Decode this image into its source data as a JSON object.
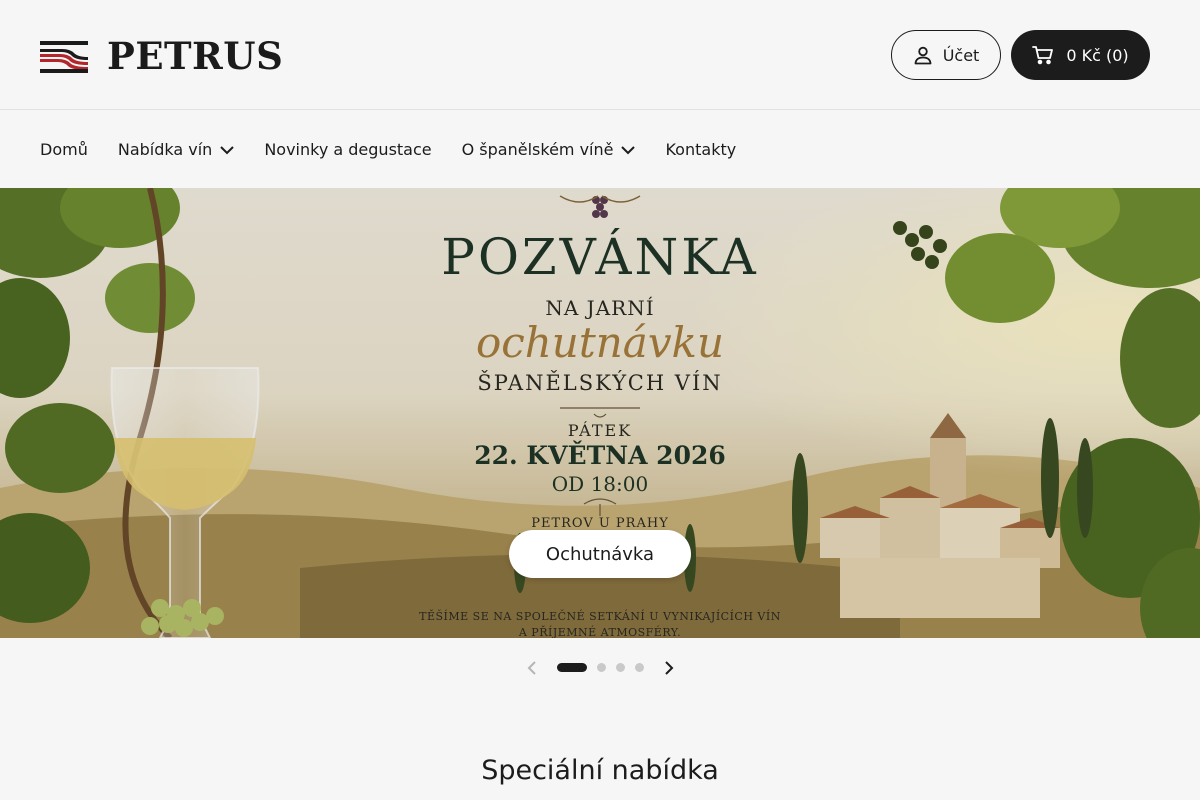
{
  "header": {
    "logo_text": "PETRUS",
    "account_label": "Účet",
    "cart_label": "0 Kč (0)"
  },
  "nav": {
    "items": [
      {
        "label": "Domů",
        "dropdown": false
      },
      {
        "label": "Nabídka vín",
        "dropdown": true
      },
      {
        "label": "Novinky a degustace",
        "dropdown": false
      },
      {
        "label": "O španělském víně",
        "dropdown": true
      },
      {
        "label": "Kontakty",
        "dropdown": false
      }
    ]
  },
  "hero": {
    "poster": {
      "title": "POZVÁNKA",
      "subtitle": "NA JARNÍ",
      "script": "ochutnávku",
      "wines": "ŠPANĚLSKÝCH VÍN",
      "day": "PÁTEK",
      "date": "22. KVĚTNA 2026",
      "time": "OD 18:00",
      "place": "PETROV U PRAHY",
      "footer_line1": "TĚŠÍME SE NA SPOLEČNÉ SETKÁNÍ U VYNIKAJÍCÍCH VÍN",
      "footer_line2": "A PŘÍJEMNÉ ATMOSFÉRY."
    },
    "button_label": "Ochutnávka"
  },
  "slider": {
    "slide_count": 4,
    "active_index": 0
  },
  "section": {
    "title": "Speciální nabídka"
  },
  "colors": {
    "dark": "#1c1c1c",
    "background": "#f6f6f6",
    "logo_red": "#b3262b",
    "poster_green": "#1f3526",
    "poster_gold": "#a57c3c"
  },
  "icons": {
    "account": "user-icon",
    "cart": "cart-icon",
    "dropdown": "chevron-down-icon",
    "prev": "chevron-left-icon",
    "next": "chevron-right-icon"
  }
}
